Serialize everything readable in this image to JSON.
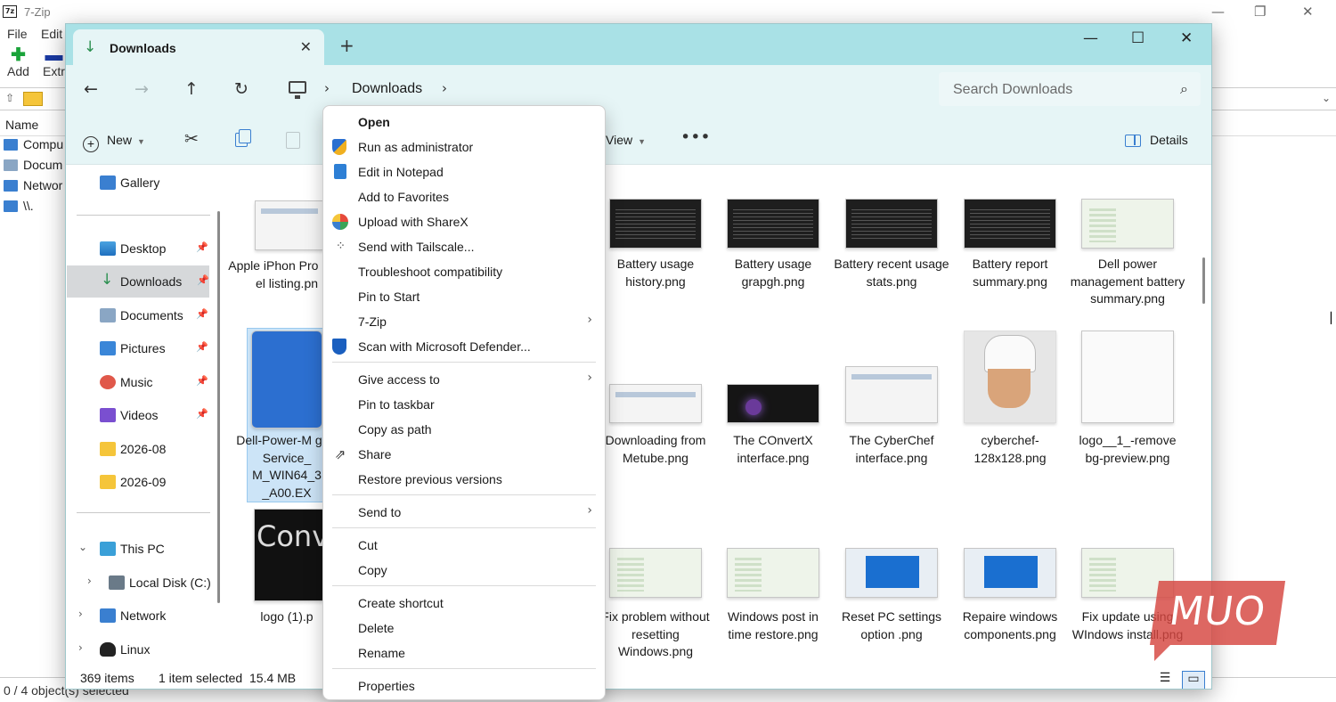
{
  "bg_app": {
    "title": "7-Zip",
    "menu": [
      "File",
      "Edit"
    ],
    "toolbar": [
      "Add",
      "Extr"
    ],
    "column_header": "Name",
    "rows": [
      "Compu",
      "Docum",
      "Networ",
      "\\\\."
    ],
    "status": "0 / 4 object(s) selected"
  },
  "explorer": {
    "tab_title": "Downloads",
    "breadcrumb": "Downloads",
    "search_placeholder": "Search Downloads",
    "cmd": {
      "new": "New",
      "view": "View",
      "details": "Details"
    },
    "sidebar": {
      "gallery": "Gallery",
      "quick": [
        "Desktop",
        "Downloads",
        "Documents",
        "Pictures",
        "Music",
        "Videos",
        "2026-08",
        "2026-09"
      ],
      "this_pc": "This PC",
      "local_disk": "Local Disk (C:)",
      "network": "Network",
      "linux": "Linux"
    },
    "files_left": {
      "f1": "Apple iPhon Pro Max el listing.pn",
      "f2": "Dell-Power-M ger-Service_ M_WIN64_3 _A00.EX",
      "f3": "logo (1).p",
      "thumb_text": "Conver"
    },
    "files": [
      "Battery usage history.png",
      "Battery usage grapgh.png",
      "Battery recent usage stats.png",
      "Battery report summary.png",
      "Dell power management battery summary.png",
      "Downloading from Metube.png",
      "The COnvertX interface.png",
      "The CyberChef interface.png",
      "cyberchef-128x128.png",
      "logo__1_-remove bg-preview.png",
      "Fix problem without resetting Windows.png",
      "Windows post in time restore.png",
      "Reset PC settings option .png",
      "Repaire windows components.png",
      "Fix update using WIndows install.png"
    ],
    "status": {
      "count": "369 items",
      "selected": "1 item selected",
      "size": "15.4 MB"
    }
  },
  "context_menu": [
    {
      "label": "Open",
      "bold": true
    },
    {
      "label": "Run as administrator"
    },
    {
      "label": "Edit in Notepad"
    },
    {
      "label": "Add to Favorites"
    },
    {
      "label": "Upload with ShareX"
    },
    {
      "label": "Send with Tailscale..."
    },
    {
      "label": "Troubleshoot compatibility"
    },
    {
      "label": "Pin to Start"
    },
    {
      "label": "7-Zip"
    },
    {
      "label": "Scan with Microsoft Defender..."
    },
    {
      "label": "Give access to"
    },
    {
      "label": "Pin to taskbar"
    },
    {
      "label": "Copy as path"
    },
    {
      "label": "Share"
    },
    {
      "label": "Restore previous versions"
    },
    {
      "label": "Send to"
    },
    {
      "label": "Cut"
    },
    {
      "label": "Copy"
    },
    {
      "label": "Create shortcut"
    },
    {
      "label": "Delete"
    },
    {
      "label": "Rename"
    },
    {
      "label": "Properties"
    }
  ],
  "watermark": "MUO",
  "colors": {
    "titlebar": "#a9e1e6",
    "toolbar": "#e6f5f6",
    "selection": "#cce4f7",
    "accent": "#3a7fd0"
  }
}
